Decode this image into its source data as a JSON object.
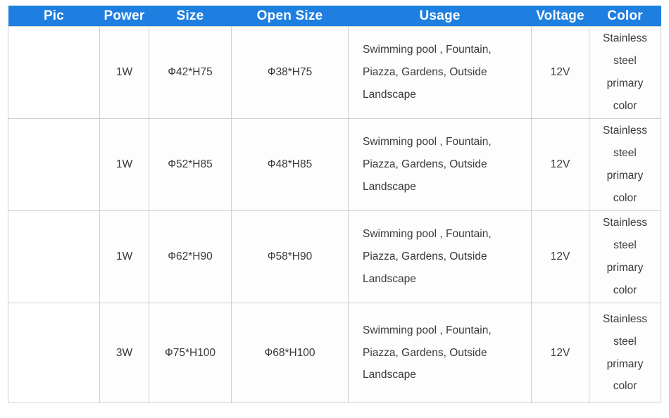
{
  "table": {
    "headers": [
      {
        "key": "pic",
        "label": "Pic"
      },
      {
        "key": "power",
        "label": "Power"
      },
      {
        "key": "size",
        "label": "Size"
      },
      {
        "key": "opensize",
        "label": "Open Size"
      },
      {
        "key": "usage",
        "label": "Usage"
      },
      {
        "key": "voltage",
        "label": "Voltage"
      },
      {
        "key": "color",
        "label": "Color"
      }
    ],
    "header_bg": "#1f7fe0",
    "header_text_color": "#ffffff",
    "border_color": "#cfcfcf",
    "cell_bg": "#fdfdfd",
    "cell_text_color": "#3a3a3a",
    "rows": [
      {
        "pic_alt": "stainless-steel-led-inground-light-1w-front",
        "power": "1W",
        "size": "Ф42*H75",
        "opensize": "Ф38*H75",
        "usage": "Swimming pool , Fountain, Piazza, Gardens, Outside Landscape",
        "voltage": "12V",
        "color": "Stainless steel primary color"
      },
      {
        "pic_alt": "stainless-steel-led-inground-light-1w-side",
        "power": "1W",
        "size": "Ф52*H85",
        "opensize": "Ф48*H85",
        "usage": "Swimming pool , Fountain, Piazza, Gardens, Outside Landscape",
        "voltage": "12V",
        "color": "Stainless steel primary color"
      },
      {
        "pic_alt": "stainless-steel-led-inground-light-1w-large",
        "power": "1W",
        "size": "Ф62*H90",
        "opensize": "Ф58*H90",
        "usage": "Swimming pool , Fountain, Piazza, Gardens, Outside Landscape",
        "voltage": "12V",
        "color": "Stainless steel primary color"
      },
      {
        "pic_alt": "stainless-steel-led-inground-light-3w-three-chip",
        "power": "3W",
        "size": "Ф75*H100",
        "opensize": "Ф68*H100",
        "usage": "Swimming pool , Fountain, Piazza, Gardens, Outside Landscape",
        "voltage": "12V",
        "color": "Stainless steel primary color"
      }
    ]
  }
}
